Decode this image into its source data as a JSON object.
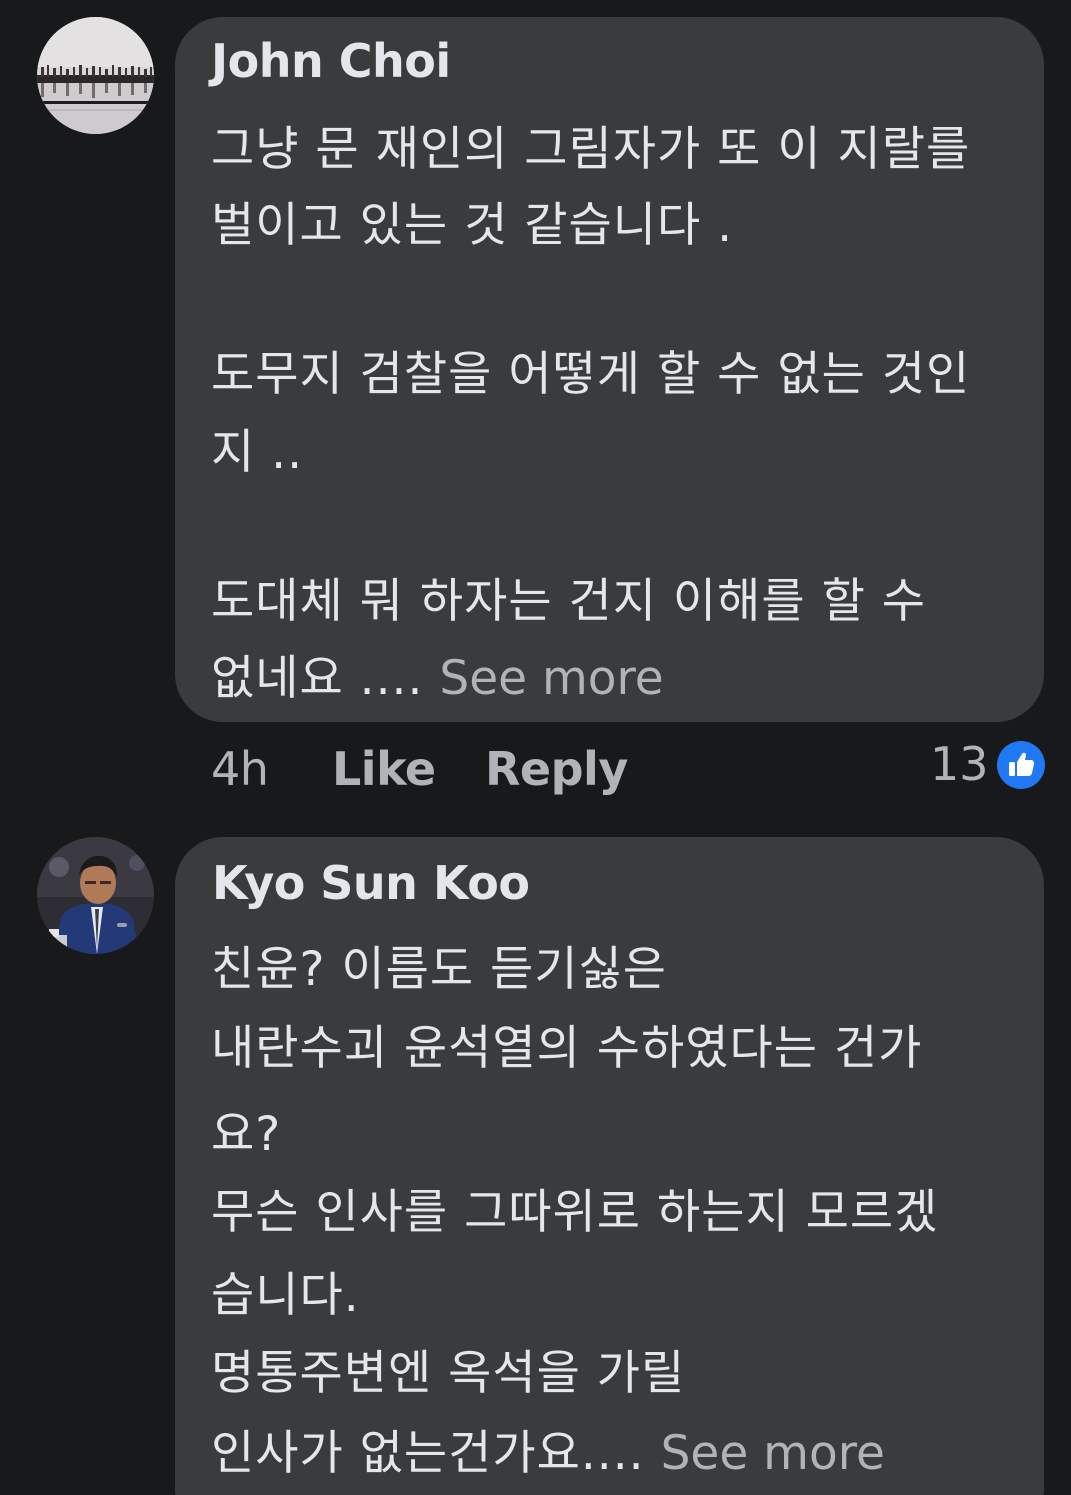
{
  "comments": [
    {
      "author": "John Choi",
      "lines": [
        "그냥 문 재인의 그림자가 또 이 지랄를",
        "벌이고 있는 것 같습니다 .",
        "",
        "도무지 검찰을 어떻게 할 수 없는 것인",
        "지 ..",
        "",
        "도대체 뭐 하자는 건지 이해를 할 수",
        "없네요 ...."
      ],
      "see_more": "See more",
      "time": "4h",
      "like_label": "Like",
      "reply_label": "Reply",
      "reaction_count": "13",
      "reaction_icon": "thumbs-up-icon",
      "reaction_color": "#2078f4"
    },
    {
      "author": "Kyo Sun Koo",
      "lines": [
        "친윤? 이름도 듣기싫은",
        "내란수괴 윤석열의 수하였다는 건가",
        "요?",
        "무슨 인사를 그따위로 하는지 모르겠",
        "습니다.",
        "명통주변엔 옥석을 가릴",
        "인사가 없는건가요...."
      ],
      "see_more": "See more"
    }
  ],
  "colors": {
    "background": "#18191a",
    "bubble": "#3a3b3c",
    "primary_text": "#e4e6eb",
    "secondary_text": "#b0b3b8"
  }
}
